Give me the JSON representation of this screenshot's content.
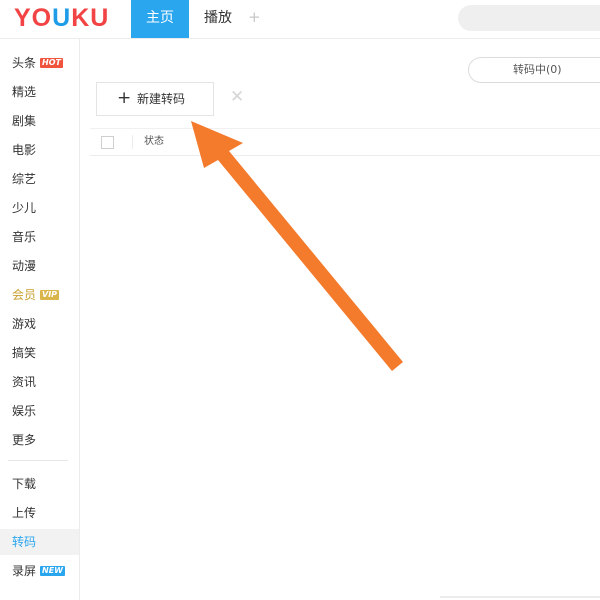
{
  "app": {
    "logo_letters": [
      "YO",
      "U",
      "KU"
    ],
    "accent_color": "#2aa6ef",
    "logo_red": "#f24444",
    "logo_blue": "#1f9ce8"
  },
  "topbar": {
    "tabs": [
      {
        "label": "主页",
        "active": true
      },
      {
        "label": "播放",
        "active": false
      }
    ],
    "add_tab": "+"
  },
  "sidebar": {
    "items": [
      {
        "label": "头条",
        "badge": "HOT"
      },
      {
        "label": "精选"
      },
      {
        "label": "剧集"
      },
      {
        "label": "电影"
      },
      {
        "label": "综艺"
      },
      {
        "label": "少儿"
      },
      {
        "label": "音乐"
      },
      {
        "label": "动漫"
      },
      {
        "label": "会员",
        "badge": "VIP"
      },
      {
        "label": "游戏"
      },
      {
        "label": "搞笑"
      },
      {
        "label": "资讯"
      },
      {
        "label": "娱乐"
      },
      {
        "label": "更多"
      }
    ],
    "tools": [
      {
        "label": "下载"
      },
      {
        "label": "上传"
      },
      {
        "label": "转码",
        "active": true
      },
      {
        "label": "录屏",
        "badge": "NEW"
      }
    ]
  },
  "main": {
    "transcoding_tab": "转码中(0)",
    "new_button_plus": "+",
    "new_button_label": "新建转码",
    "close_symbol": "✕",
    "table_column_status": "状态"
  },
  "annotation": {
    "arrow_color": "#f47a2c"
  }
}
